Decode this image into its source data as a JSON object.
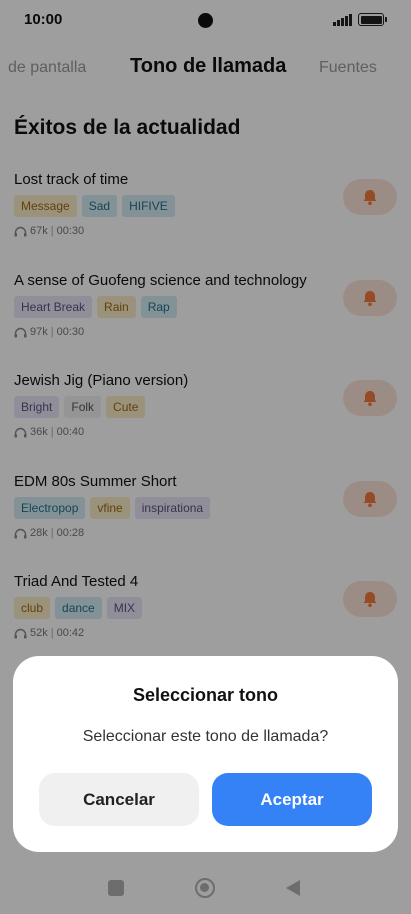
{
  "status_bar": {
    "time": "10:00",
    "icons": [
      "signal-icon",
      "battery-icon"
    ]
  },
  "tabs": {
    "left": "de pantalla",
    "center": "Tono de llamada",
    "right": "Fuentes"
  },
  "section_title": "Éxitos de la actualidad",
  "songs": [
    {
      "title": "Lost track of time",
      "tags": [
        "Message",
        "Sad",
        "HIFIVE"
      ],
      "plays": "67k",
      "duration": "00:30"
    },
    {
      "title": "A sense of Guofeng science and technology",
      "tags": [
        "Heart Break",
        "Rain",
        "Rap"
      ],
      "plays": "97k",
      "duration": "00:30"
    },
    {
      "title": "Jewish Jig (Piano version)",
      "tags": [
        "Bright",
        "Folk",
        "Cute"
      ],
      "plays": "36k",
      "duration": "00:40"
    },
    {
      "title": "EDM 80s Summer Short",
      "tags": [
        "Electropop",
        "vfine",
        "inspirationa"
      ],
      "plays": "28k",
      "duration": "00:28"
    },
    {
      "title": "Triad And Tested 4",
      "tags": [
        "club",
        "dance",
        "MIX"
      ],
      "plays": "52k",
      "duration": "00:42"
    }
  ],
  "dialog": {
    "title": "Seleccionar tono",
    "message": "Seleccionar este tono de llamada?",
    "cancel_label": "Cancelar",
    "accept_label": "Aceptar"
  },
  "colors": {
    "accent": "#3482f6",
    "bell": "#f07a3c",
    "bell_bg": "#fce3d9"
  }
}
